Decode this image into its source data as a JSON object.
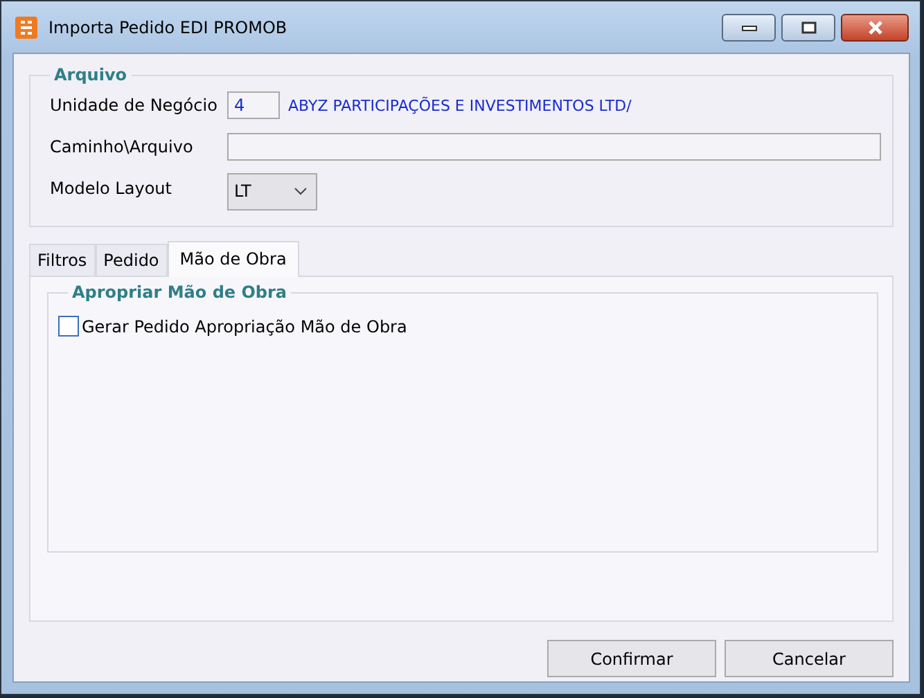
{
  "window": {
    "title": "Importa Pedido EDI PROMOB"
  },
  "arquivo": {
    "title": "Arquivo",
    "unidade_label": "Unidade de Negócio",
    "unidade_code": "4",
    "unidade_name": "ABYZ PARTICIPAÇÕES E INVESTIMENTOS LTD/",
    "caminho_label": "Caminho\\Arquivo",
    "modelo_label": "Modelo Layout",
    "modelo_value": "LT"
  },
  "tabs": [
    {
      "label": "Filtros",
      "selected": false
    },
    {
      "label": "Pedido",
      "selected": false
    },
    {
      "label": "Mão de Obra",
      "selected": true
    }
  ],
  "group": {
    "title": "Apropriar Mão de Obra",
    "checkbox": {
      "label": "Gerar Pedido Apropriação Mão de Obra",
      "checked": false
    }
  },
  "buttons": [
    "Confirmar",
    "Cancelar"
  ]
}
